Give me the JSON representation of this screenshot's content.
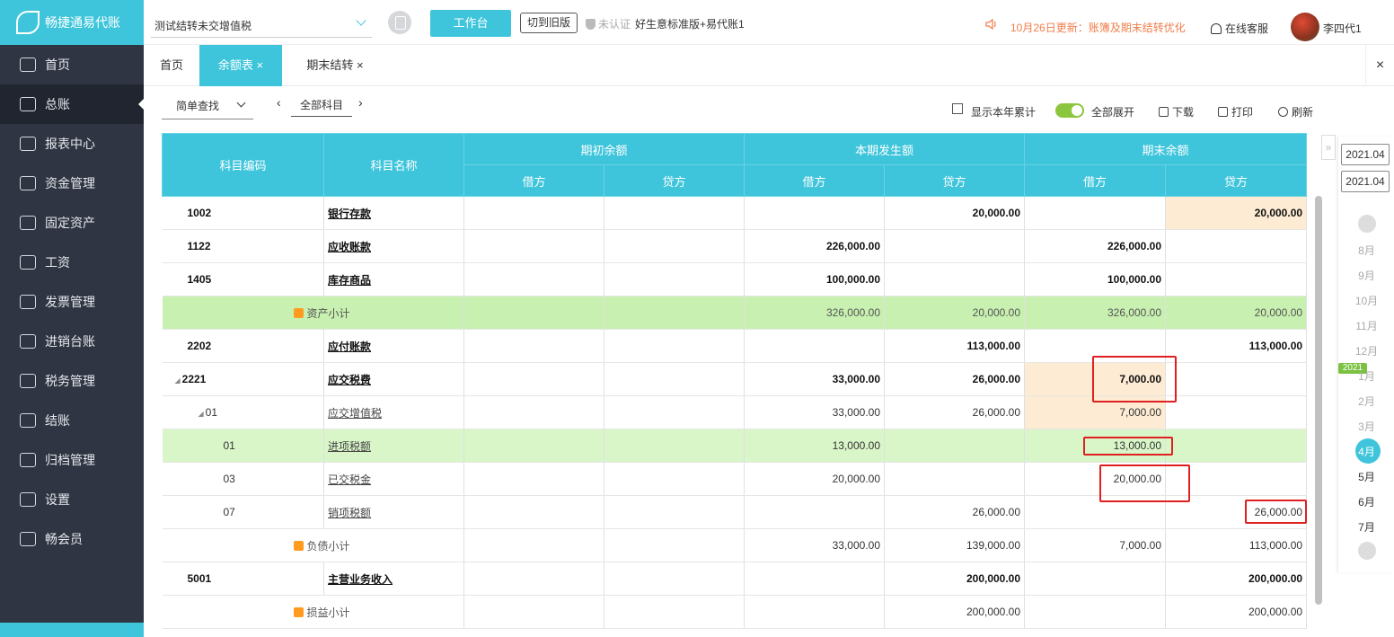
{
  "app": {
    "name": "畅捷通易代账"
  },
  "sidebar": {
    "items": [
      {
        "label": "首页",
        "icon": "home-icon"
      },
      {
        "label": "总账",
        "icon": "ledger-icon",
        "active": true
      },
      {
        "label": "报表中心",
        "icon": "chart-icon"
      },
      {
        "label": "资金管理",
        "icon": "money-icon"
      },
      {
        "label": "固定资产",
        "icon": "building-icon"
      },
      {
        "label": "工资",
        "icon": "salary-icon"
      },
      {
        "label": "发票管理",
        "icon": "invoice-icon"
      },
      {
        "label": "进销台账",
        "icon": "inventory-icon"
      },
      {
        "label": "税务管理",
        "icon": "tax-icon"
      },
      {
        "label": "结账",
        "icon": "checkout-icon"
      },
      {
        "label": "归档管理",
        "icon": "archive-icon"
      },
      {
        "label": "设置",
        "icon": "gear-icon"
      },
      {
        "label": "畅会员",
        "icon": "vip-icon"
      }
    ]
  },
  "header": {
    "company": "测试结转未交增值税",
    "workbench": "工作台",
    "old_version": "切到旧版",
    "certification": "未认证",
    "plan": "好生意标准版+易代账1",
    "notice": "10月26日更新：账簿及期末结转优化",
    "service": "在线客服",
    "user": "李四代1"
  },
  "tabs": [
    {
      "label": "首页",
      "closable": false
    },
    {
      "label": "余额表",
      "closable": true,
      "active": true
    },
    {
      "label": "期末结转",
      "closable": true
    }
  ],
  "toolbar": {
    "query_mode": "简单查找",
    "subject_range": "全部科目",
    "show_year_total": "显示本年累计",
    "expand_all": "全部展开",
    "download": "下载",
    "print": "打印",
    "refresh": "刷新"
  },
  "table": {
    "headers": {
      "code": "科目编码",
      "name": "科目名称",
      "opening": "期初余额",
      "current": "本期发生额",
      "closing": "期末余额",
      "debit": "借方",
      "credit": "贷方"
    },
    "rows": [
      {
        "code": "1002",
        "name": "银行存款",
        "od": "",
        "oc": "",
        "cd": "",
        "cc": "20,000.00",
        "ed": "",
        "ec": "20,000.00"
      },
      {
        "code": "1122",
        "name": "应收账款",
        "od": "",
        "oc": "",
        "cd": "226,000.00",
        "cc": "",
        "ed": "226,000.00",
        "ec": ""
      },
      {
        "code": "1405",
        "name": "库存商品",
        "od": "",
        "oc": "",
        "cd": "100,000.00",
        "cc": "",
        "ed": "100,000.00",
        "ec": ""
      },
      {
        "subtotal": "资产小计",
        "od": "",
        "oc": "",
        "cd": "326,000.00",
        "cc": "20,000.00",
        "ed": "326,000.00",
        "ec": "20,000.00"
      },
      {
        "code": "2202",
        "name": "应付账款",
        "od": "",
        "oc": "",
        "cd": "",
        "cc": "113,000.00",
        "ed": "",
        "ec": "113,000.00"
      },
      {
        "code": "2221",
        "name": "应交税费",
        "od": "",
        "oc": "",
        "cd": "33,000.00",
        "cc": "26,000.00",
        "ed": "7,000.00",
        "ec": ""
      },
      {
        "code": "01",
        "name": "应交增值税",
        "od": "",
        "oc": "",
        "cd": "33,000.00",
        "cc": "26,000.00",
        "ed": "7,000.00",
        "ec": ""
      },
      {
        "code": "01",
        "name": "进项税额",
        "od": "",
        "oc": "",
        "cd": "13,000.00",
        "cc": "",
        "ed": "13,000.00",
        "ec": ""
      },
      {
        "code": "03",
        "name": "已交税金",
        "od": "",
        "oc": "",
        "cd": "20,000.00",
        "cc": "",
        "ed": "20,000.00",
        "ec": ""
      },
      {
        "code": "07",
        "name": "销项税额",
        "od": "",
        "oc": "",
        "cd": "",
        "cc": "26,000.00",
        "ed": "",
        "ec": "26,000.00"
      },
      {
        "subtotal": "负债小计",
        "od": "",
        "oc": "",
        "cd": "33,000.00",
        "cc": "139,000.00",
        "ed": "7,000.00",
        "ec": "113,000.00"
      },
      {
        "code": "5001",
        "name": "主营业务收入",
        "od": "",
        "oc": "",
        "cd": "",
        "cc": "200,000.00",
        "ed": "",
        "ec": "200,000.00"
      },
      {
        "subtotal": "损益小计",
        "od": "",
        "oc": "",
        "cd": "",
        "cc": "200,000.00",
        "ed": "",
        "ec": "200,000.00"
      }
    ]
  },
  "period": {
    "start": "2021.04",
    "end": "2021.04",
    "year_badge": "2021",
    "months": [
      "8月",
      "9月",
      "10月",
      "11月",
      "12月",
      "1月",
      "2月",
      "3月",
      "4月",
      "5月",
      "6月",
      "7月"
    ],
    "current": "4月"
  },
  "colors": {
    "accent": "#3fc5db",
    "sidebar": "#2f3543",
    "subtotal_green": "#c8f0b0",
    "highlight": "#fdebd3",
    "annotation_red": "#e02020"
  }
}
